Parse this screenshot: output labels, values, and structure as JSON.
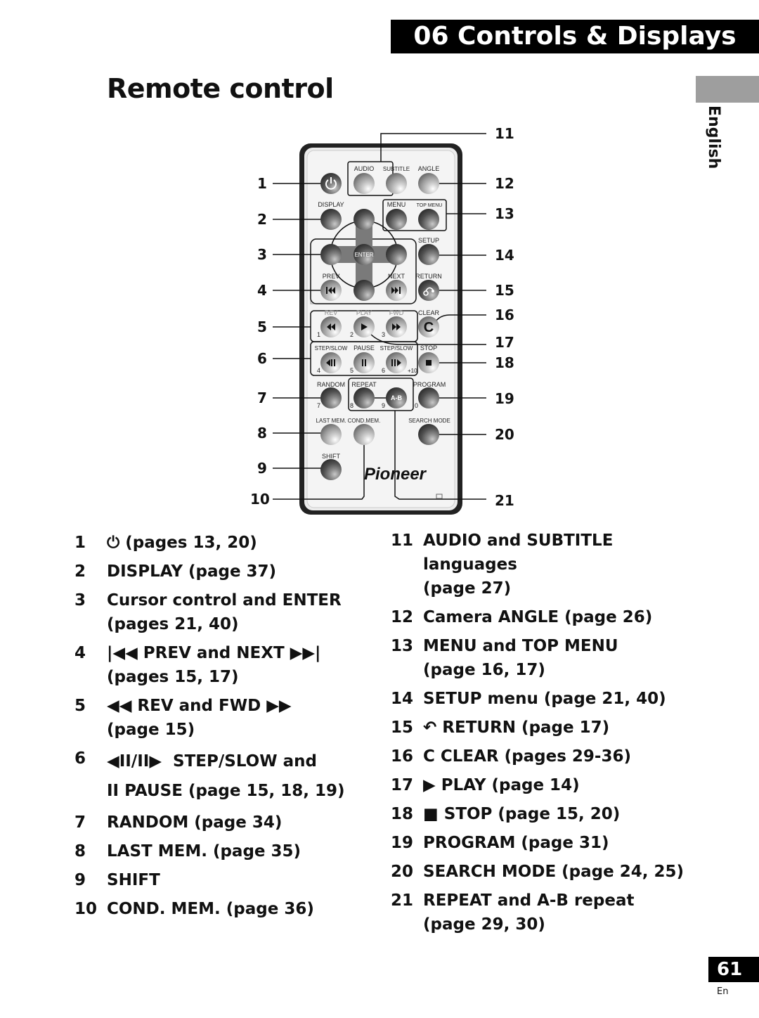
{
  "header": {
    "section_title": "06 Controls & Displays"
  },
  "page": {
    "title": "Remote control",
    "language_tab": "English",
    "page_number": "61",
    "page_lang": "En"
  },
  "remote": {
    "brand": "Pioneer",
    "button_labels": {
      "audio": "AUDIO",
      "subtitle": "SUBTITLE",
      "angle": "ANGLE",
      "display": "DISPLAY",
      "menu": "MENU",
      "top_menu": "TOP MENU",
      "setup": "SETUP",
      "enter": "ENTER",
      "prev": "PREV",
      "next": "NEXT",
      "return": "RETURN",
      "rev": "REV",
      "play": "PLAY",
      "fwd": "FWD",
      "clear": "CLEAR",
      "step_slow_back": "STEP/SLOW",
      "pause": "PAUSE",
      "step_slow_fwd": "STEP/SLOW",
      "stop": "STOP",
      "random": "RANDOM",
      "repeat": "REPEAT",
      "ab": "A-B",
      "program": "PROGRAM",
      "last_mem": "LAST MEM.",
      "cond_mem": "COND.MEM.",
      "search_mode": "SEARCH MODE",
      "shift": "SHIFT"
    },
    "digits": {
      "d1": "1",
      "d2": "2",
      "d3": "3",
      "d4": "4",
      "d5": "5",
      "d6": "6",
      "d7": "7",
      "d8": "8",
      "d9": "9",
      "d0": "0",
      "plus10": "+10"
    },
    "callouts_left": [
      "1",
      "2",
      "3",
      "4",
      "5",
      "6",
      "7",
      "8",
      "9",
      "10"
    ],
    "callouts_right": [
      "11",
      "12",
      "13",
      "14",
      "15",
      "16",
      "17",
      "18",
      "19",
      "20",
      "21"
    ]
  },
  "legend_left": [
    {
      "num": "1",
      "icon": "power-icon",
      "symbol": "⏻",
      "text": "(pages 13, 20)"
    },
    {
      "num": "2",
      "text": "DISPLAY (page 37)"
    },
    {
      "num": "3",
      "text": "Cursor control and ENTER",
      "text2": "(pages 21, 40)"
    },
    {
      "num": "4",
      "icon": "prev-next-icon",
      "symbol": "|◀◀",
      "text": "PREV and NEXT",
      "symbol_after": "▶▶|",
      "text2": "(pages 15, 17)"
    },
    {
      "num": "5",
      "icon": "rev-fwd-icon",
      "symbol": "◀◀",
      "text": "REV and FWD",
      "symbol_after": "▶▶",
      "text2": "(page 15)"
    },
    {
      "num": "6",
      "icon": "step-slow-icon",
      "symbol": "◀II/II▶",
      "text": "STEP/SLOW and",
      "symbol2": "II",
      "text2": "PAUSE (page 15, 18, 19)"
    },
    {
      "num": "7",
      "text": "RANDOM (page 34)"
    },
    {
      "num": "8",
      "text": "LAST MEM. (page 35)"
    },
    {
      "num": "9",
      "text": "SHIFT"
    },
    {
      "num": "10",
      "text": "COND. MEM. (page 36)"
    }
  ],
  "legend_right": [
    {
      "num": "11",
      "text": "AUDIO and SUBTITLE languages",
      "text2": "(page 27)"
    },
    {
      "num": "12",
      "text": "Camera ANGLE (page 26)"
    },
    {
      "num": "13",
      "text": "MENU and TOP MENU",
      "text2": "(page 16, 17)"
    },
    {
      "num": "14",
      "text": "SETUP menu (page 21, 40)"
    },
    {
      "num": "15",
      "icon": "return-icon",
      "symbol": "↶",
      "text": "RETURN (page 17)"
    },
    {
      "num": "16",
      "text": "C CLEAR (pages 29-36)"
    },
    {
      "num": "17",
      "icon": "play-icon",
      "symbol": "▶",
      "text": "PLAY (page 14)"
    },
    {
      "num": "18",
      "icon": "stop-icon",
      "symbol": "■",
      "text": "STOP (page 15, 20)"
    },
    {
      "num": "19",
      "text": "PROGRAM (page 31)"
    },
    {
      "num": "20",
      "text": "SEARCH MODE (page 24, 25)"
    },
    {
      "num": "21",
      "text": "REPEAT and A-B repeat",
      "text2": "(page 29, 30)"
    }
  ]
}
